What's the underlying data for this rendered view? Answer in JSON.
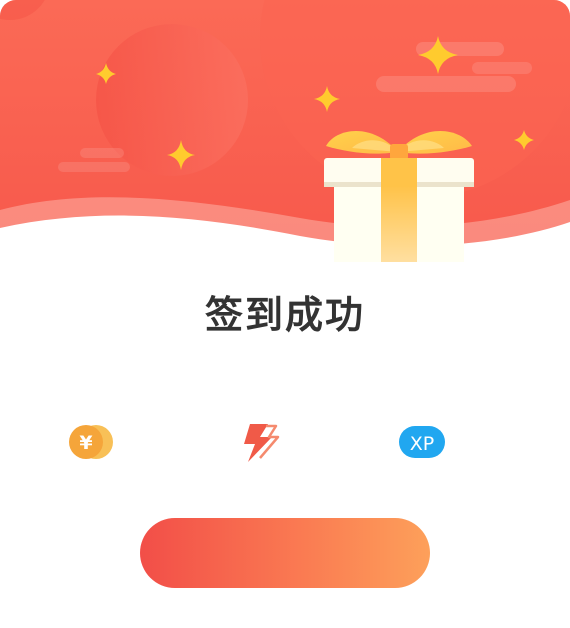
{
  "dialog": {
    "title": "签到成功",
    "confirm_label": ""
  },
  "rewards": [
    {
      "icon": "coin-icon",
      "glyph": "¥",
      "value": ""
    },
    {
      "icon": "energy-icon",
      "value": ""
    },
    {
      "icon": "xp-icon",
      "glyph": "XP",
      "value": ""
    }
  ],
  "colors": {
    "header_top": "#fb6a56",
    "header_bottom": "#f7584b",
    "button_start": "#f24e48",
    "button_end": "#fda05a",
    "coin": "#f5a53a",
    "energy": "#f05a48",
    "xp": "#21a7f0",
    "sparkle": "#ffcb2e",
    "title_text": "#333333"
  }
}
